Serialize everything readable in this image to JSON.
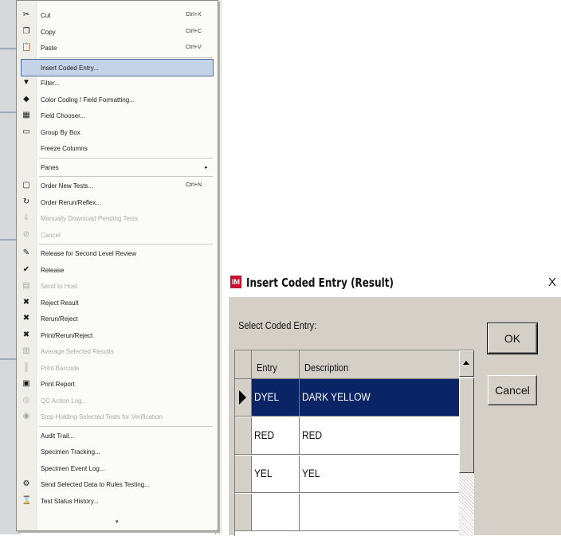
{
  "context_menu": {
    "items": [
      {
        "icon": "cut-icon",
        "glyph": "✂",
        "label": "Cut",
        "shortcut": "Ctrl+X",
        "disabled": false
      },
      {
        "icon": "copy-icon",
        "glyph": "❐",
        "label": "Copy",
        "shortcut": "Ctrl+C",
        "disabled": false
      },
      {
        "icon": "paste-icon",
        "glyph": "📋",
        "label": "Paste",
        "shortcut": "Ctrl+V",
        "disabled": false
      },
      {
        "icon": "",
        "glyph": "",
        "label": "Insert Coded Entry...",
        "shortcut": "",
        "disabled": false,
        "highlighted": true
      },
      {
        "icon": "filter-icon",
        "glyph": "▼",
        "label": "Filter...",
        "shortcut": "",
        "disabled": false
      },
      {
        "icon": "color-coding-icon",
        "glyph": "◆",
        "label": "Color Coding / Field Formatting...",
        "shortcut": "",
        "disabled": false
      },
      {
        "icon": "field-chooser-icon",
        "glyph": "▦",
        "label": "Field Chooser...",
        "shortcut": "",
        "disabled": false
      },
      {
        "icon": "group-by-icon",
        "glyph": "▭",
        "label": "Group By Box",
        "shortcut": "",
        "disabled": false
      },
      {
        "icon": "",
        "glyph": "",
        "label": "Freeze Columns",
        "shortcut": "",
        "disabled": false
      },
      {
        "icon": "",
        "glyph": "",
        "label": "Panes",
        "shortcut": "",
        "disabled": false,
        "submenu": true
      },
      {
        "icon": "order-new-tests-icon",
        "glyph": "▢",
        "label": "Order New Tests...",
        "shortcut": "Ctrl+N",
        "disabled": false
      },
      {
        "icon": "order-rerun-icon",
        "glyph": "↻",
        "label": "Order Rerun/Reflex...",
        "shortcut": "",
        "disabled": false
      },
      {
        "icon": "download-icon",
        "glyph": "⇩",
        "label": "Manually Download Pending Tests",
        "shortcut": "",
        "disabled": true
      },
      {
        "icon": "cancel-icon",
        "glyph": "⊘",
        "label": "Cancel",
        "shortcut": "",
        "disabled": true
      },
      {
        "icon": "release-second-review-icon",
        "glyph": "✎",
        "label": "Release for Second Level Review",
        "shortcut": "",
        "disabled": false
      },
      {
        "icon": "release-icon",
        "glyph": "✔",
        "label": "Release",
        "shortcut": "",
        "disabled": false
      },
      {
        "icon": "send-to-host-icon",
        "glyph": "▤",
        "label": "Send to Host",
        "shortcut": "",
        "disabled": true
      },
      {
        "icon": "reject-result-icon",
        "glyph": "✖",
        "label": "Reject Result",
        "shortcut": "",
        "disabled": false
      },
      {
        "icon": "rerun-reject-icon",
        "glyph": "✖",
        "label": "Rerun/Reject",
        "shortcut": "",
        "disabled": false
      },
      {
        "icon": "print-rerun-reject-icon",
        "glyph": "✖",
        "label": "Print/Rerun/Reject",
        "shortcut": "",
        "disabled": false
      },
      {
        "icon": "average-results-icon",
        "glyph": "▥",
        "label": "Average Selected Results",
        "shortcut": "",
        "disabled": true
      },
      {
        "icon": "print-barcode-icon",
        "glyph": "║",
        "label": "Print Barcode",
        "shortcut": "",
        "disabled": true
      },
      {
        "icon": "print-report-icon",
        "glyph": "▣",
        "label": "Print Report",
        "shortcut": "",
        "disabled": false
      },
      {
        "icon": "qc-action-log-icon",
        "glyph": "◎",
        "label": "QC Action Log...",
        "shortcut": "",
        "disabled": true
      },
      {
        "icon": "stop-holding-icon",
        "glyph": "◉",
        "label": "Stop Holding Selected Tests for Verification",
        "shortcut": "",
        "disabled": true
      },
      {
        "icon": "",
        "glyph": "",
        "label": "Audit Trail...",
        "shortcut": "",
        "disabled": false
      },
      {
        "icon": "",
        "glyph": "",
        "label": "Specimen Tracking...",
        "shortcut": "",
        "disabled": false
      },
      {
        "icon": "",
        "glyph": "",
        "label": "Specimen Event Log...",
        "shortcut": "",
        "disabled": false
      },
      {
        "icon": "rules-testing-icon",
        "glyph": "⚙",
        "label": "Send Selected Data to Rules Testing...",
        "shortcut": "",
        "disabled": false
      },
      {
        "icon": "test-status-history-icon",
        "glyph": "⌛",
        "label": "Test Status History...",
        "shortcut": "",
        "disabled": false
      }
    ],
    "more_arrow": "▾"
  },
  "dialog": {
    "title": "Insert Coded Entry (Result)",
    "title_icon_text": "IM",
    "close_label": "X",
    "select_label": "Select Coded Entry:",
    "ok_label": "OK",
    "cancel_label": "Cancel",
    "columns": [
      "Entry",
      "Description"
    ],
    "rows": [
      {
        "entry": "DYEL",
        "description": "DARK YELLOW",
        "selected": true
      },
      {
        "entry": "RED",
        "description": "RED",
        "selected": false
      },
      {
        "entry": "YEL",
        "description": "YEL",
        "selected": false
      },
      {
        "entry": "",
        "description": "",
        "selected": false
      }
    ]
  },
  "colors": {
    "selection": "#0b2466",
    "menu_highlight": "#c4d3e7",
    "dialog_face": "#d4d0c8",
    "title_icon": "#c8102e"
  }
}
